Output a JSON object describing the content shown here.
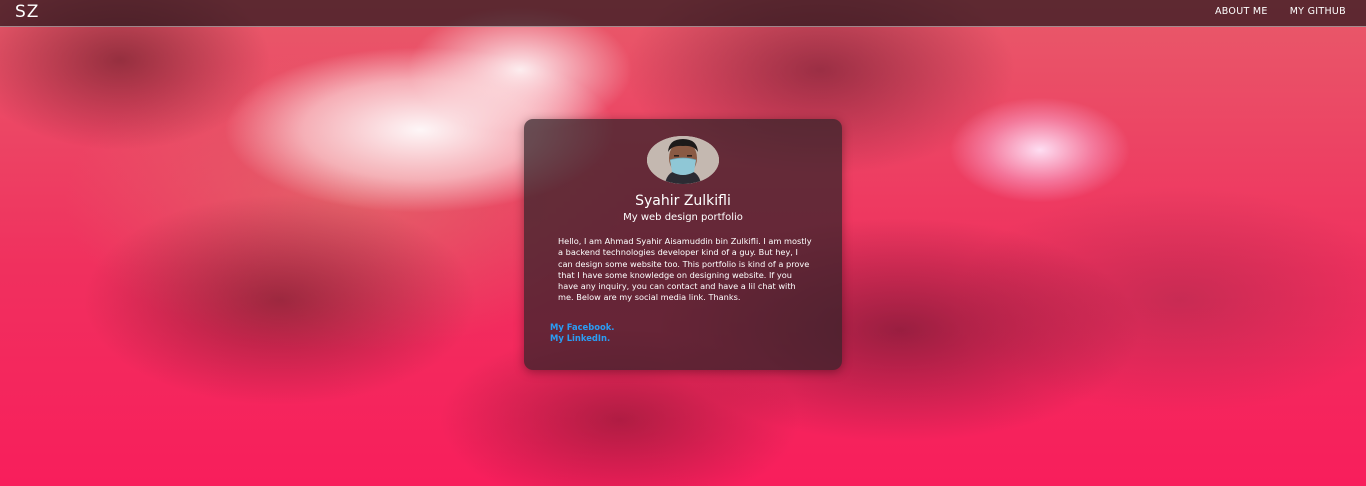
{
  "navbar": {
    "brand": "SZ",
    "links": [
      "ABOUT ME",
      "MY GITHUB"
    ]
  },
  "profile": {
    "name": "Syahir Zulkifli",
    "subtitle": "My web design portfolio",
    "bio": "Hello, I am Ahmad Syahir Aisamuddin bin Zulkifli. I am mostly a backend technologies developer kind of a guy. But hey, I can design some website too. This portfolio is kind of a prove that I have some knowledge on designing website. If you have any inquiry, you can contact and have a lil chat with me. Below are my social media link. Thanks.",
    "social_links": [
      "My Facebook.",
      "My LinkedIn."
    ]
  },
  "colors": {
    "link": "#2a9df4",
    "background_accent": "#f81e5c"
  }
}
